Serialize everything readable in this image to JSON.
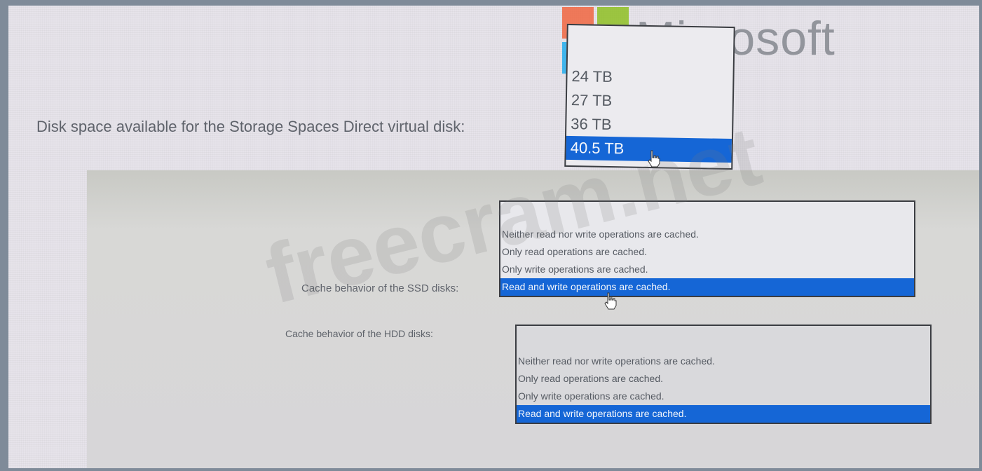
{
  "colors": {
    "selection": "#1566d6",
    "label_text": "#5f636b",
    "panel_band": "#d2d2d2",
    "ms_red": "#f25022",
    "ms_green": "#7fba00",
    "ms_blue": "#00a4ef",
    "ms_yellow": "#ffb900"
  },
  "brand": {
    "logo_text": "Microsoft"
  },
  "watermark": {
    "text": "freecram.net"
  },
  "disk_space": {
    "label": "Disk space available for the Storage Spaces Direct virtual disk:",
    "options": [
      "24 TB",
      "27 TB",
      "36 TB",
      "40.5 TB"
    ],
    "selected": "40.5 TB"
  },
  "ssd_cache": {
    "label": "Cache behavior of the SSD disks:",
    "options": [
      "Neither read nor write operations are cached.",
      "Only read operations are cached.",
      "Only write operations are cached.",
      "Read and write operations are cached."
    ],
    "selected": "Read and write operations are cached."
  },
  "hdd_cache": {
    "label": "Cache behavior of the HDD disks:",
    "options": [
      "Neither read nor write operations are cached.",
      "Only read operations are cached.",
      "Only write operations are cached.",
      "Read and write operations are cached."
    ],
    "selected": "Read and write operations are cached."
  }
}
